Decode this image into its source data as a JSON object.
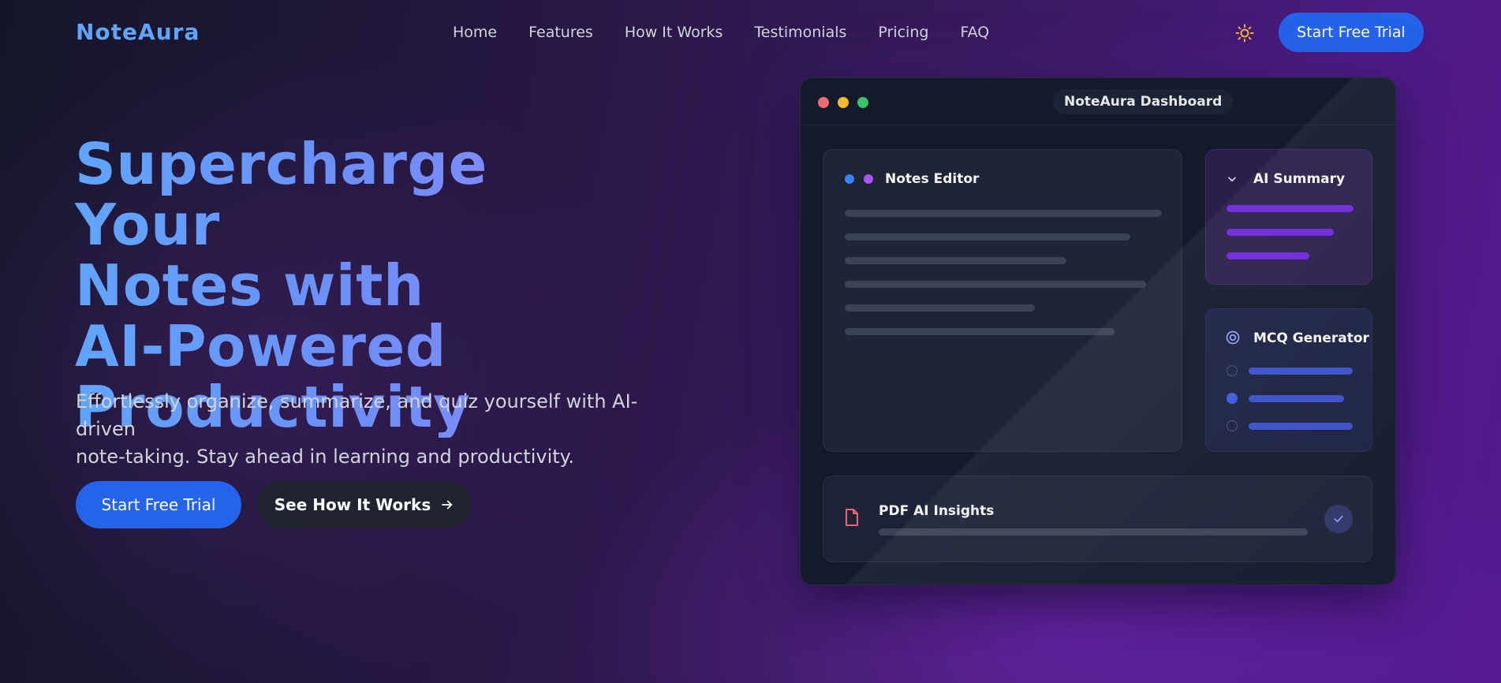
{
  "header": {
    "logo": "NoteAura",
    "nav": [
      "Home",
      "Features",
      "How It Works",
      "Testimonials",
      "Pricing",
      "FAQ"
    ],
    "theme_icon": "sun-icon",
    "cta_label": "Start Free Trial"
  },
  "hero": {
    "title_lines": [
      "Supercharge Your",
      "Notes with",
      "AI-Powered",
      "Productivity"
    ],
    "subtitle_lines": [
      "Effortlessly organize, summarize, and quiz yourself with AI-driven",
      "note-taking. Stay ahead in learning and productivity."
    ],
    "primary_cta": "Start Free Trial",
    "secondary_cta": "See How It Works",
    "secondary_icon": "arrow-right-icon"
  },
  "dashboard": {
    "title": "NoteAura Dashboard",
    "window_dots": [
      "#ef6b73",
      "#f5b82e",
      "#35c46a"
    ],
    "editor": {
      "title": "Notes Editor",
      "dots": [
        "#3b82f6",
        "#a855f7"
      ]
    },
    "summary": {
      "title": "AI Summary",
      "icon": "chevron-down-icon"
    },
    "mcq": {
      "title": "MCQ Generator",
      "icon": "target-icon",
      "selected_option": 2
    },
    "pdf": {
      "title": "PDF AI Insights",
      "icon": "file-icon",
      "status_icon": "check-icon"
    }
  },
  "colors": {
    "accent": "#2563eb",
    "logo": "#60a5fa",
    "sun": "#f5b82e"
  }
}
